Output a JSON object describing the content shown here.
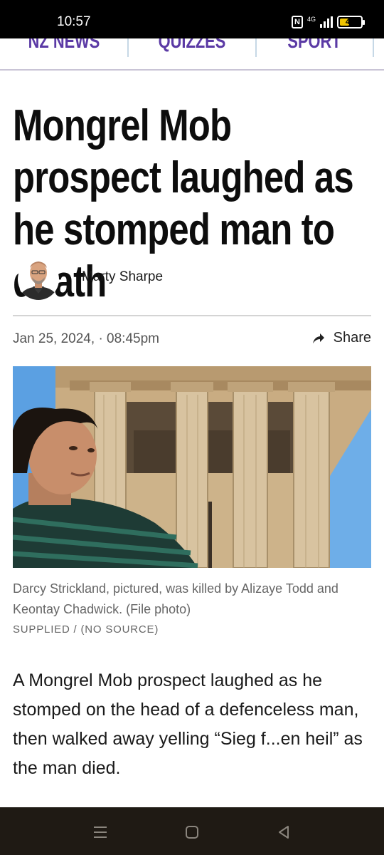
{
  "status_bar": {
    "time": "10:57",
    "network": "4G",
    "battery": "42",
    "battery_level": 0.42,
    "battery_color": "#f0c400"
  },
  "nav": {
    "items": [
      {
        "label": "NZ NEWS"
      },
      {
        "label": "QUIZZES"
      },
      {
        "label": "SPORT"
      }
    ],
    "accent": "#5b3aa5"
  },
  "article": {
    "headline": "Mongrel Mob prospect laughed as he stomped man to death",
    "author": "Marty Sharpe",
    "date": "Jan 25, 2024,",
    "time_sep": "·",
    "time": "08:45pm",
    "share_label": "Share",
    "caption": "Darcy Strickland, pictured, was killed by Alizaye Todd and Keontay Chadwick. (File photo)",
    "credit": "SUPPLIED / (NO SOURCE)",
    "lead": "A Mongrel Mob prospect laughed as he stomped on the head of a defenceless man, then walked away yelling “Sieg f...en heil” as the man died."
  },
  "icons": {
    "share": "share-arrow-icon",
    "menu": "menu-icon",
    "home": "home-icon",
    "back": "back-icon"
  }
}
